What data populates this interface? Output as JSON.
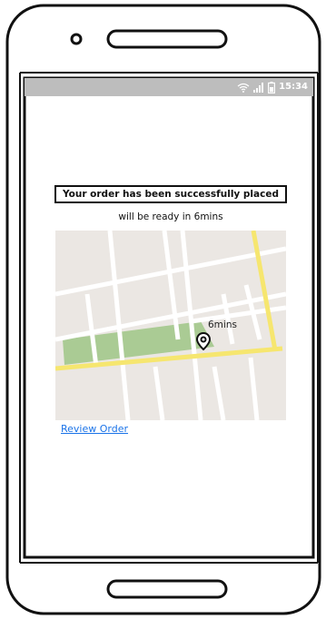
{
  "status_bar": {
    "time": "15:34",
    "icons": [
      "wifi-icon",
      "signal-icon",
      "battery-icon"
    ]
  },
  "order": {
    "confirmation": "Your order has been successfully placed",
    "ready_text": "will be ready in 6mins"
  },
  "map": {
    "eta_label": "6mins",
    "pin_icon": "location-pin-icon"
  },
  "actions": {
    "review_order": "Review Order"
  },
  "colors": {
    "status_bar": "#bdbdbd",
    "link": "#1a73e8",
    "map_land": "#ebe7e3",
    "map_road": "#ffffff",
    "map_highway": "#f6e66f",
    "map_park": "#aacb94"
  }
}
